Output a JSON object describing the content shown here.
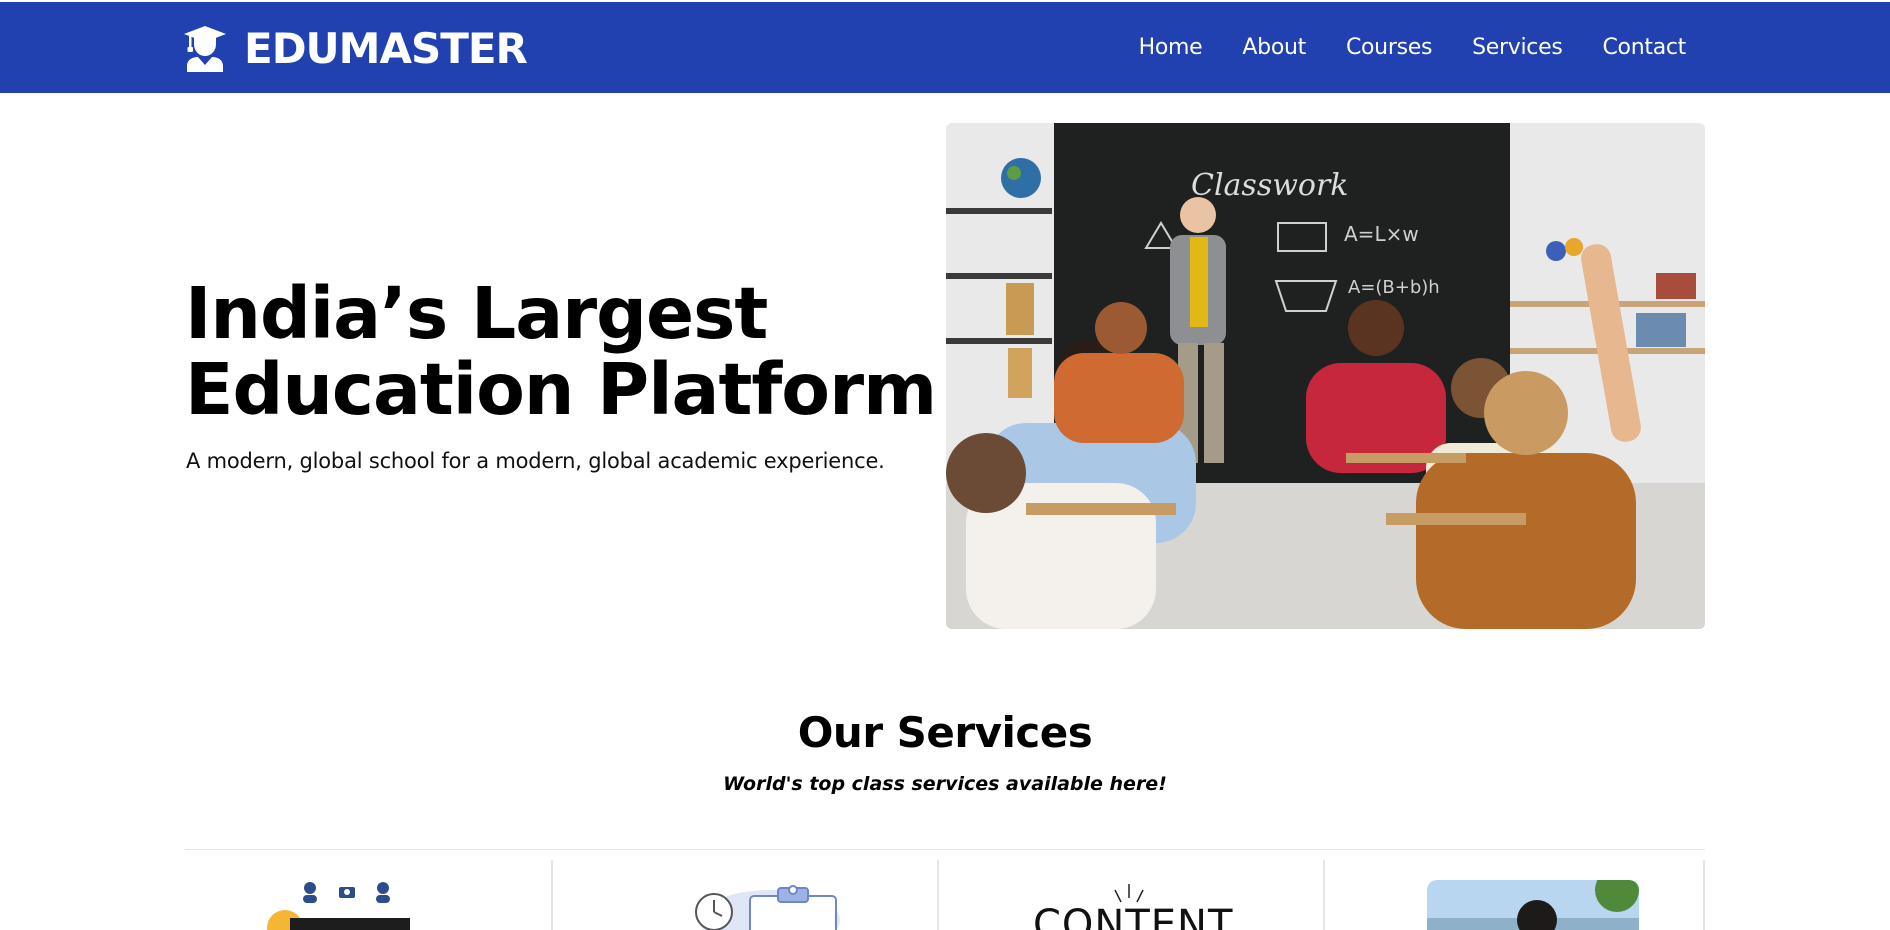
{
  "brand": {
    "name": "EDUMASTER",
    "icon": "graduate-icon"
  },
  "nav": {
    "items": [
      {
        "label": "Home"
      },
      {
        "label": "About"
      },
      {
        "label": "Courses"
      },
      {
        "label": "Services"
      },
      {
        "label": "Contact"
      }
    ]
  },
  "hero": {
    "title_line1": "India’s Largest",
    "title_line2": "Education Platform",
    "subtitle": "A modern, global school for a modern, global academic experience.",
    "image": "classroom-photo"
  },
  "services": {
    "title": "Our Services",
    "subtitle": "World's top class services available here!",
    "cards": [
      {
        "image": "online-class-illustration"
      },
      {
        "image": "schedule-clipboard-illustration"
      },
      {
        "image": "content-lettering-illustration",
        "text": "CONTENT"
      },
      {
        "image": "student-photo"
      }
    ]
  },
  "colors": {
    "navbar": "#2141b1",
    "text": "#000000",
    "nav_text": "#ffffff"
  }
}
